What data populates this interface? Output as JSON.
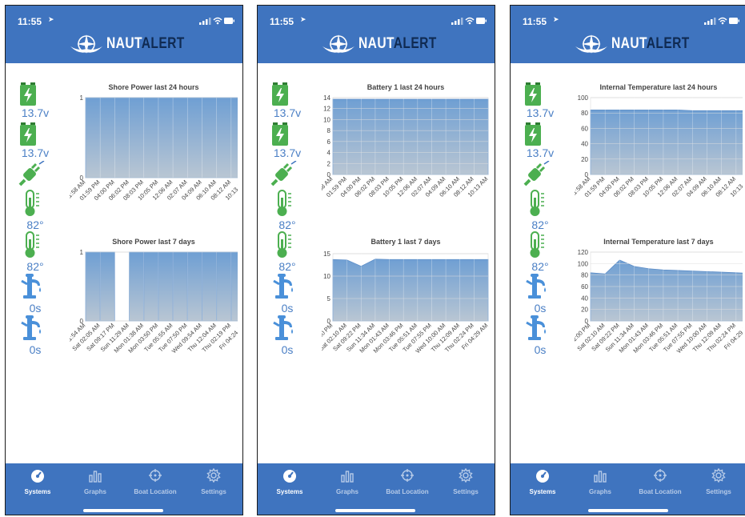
{
  "colors": {
    "header": "#3f74bf",
    "tab_active": "#ffffff",
    "tab_inactive": "#b7cbe8",
    "side_value": "#4a7fc5",
    "battery_icon": "#4caf50",
    "plug_icon": "#4caf50",
    "thermometer_icon": "#4caf50",
    "pump_icon": "#4a90d9",
    "area_top": "#6f9fd3",
    "area_bottom": "#b9c6d3"
  },
  "screens": [
    {
      "status_time": "11:55",
      "logo": {
        "part1": "NAUT",
        "part2": "ALERT"
      },
      "sidebar": [
        {
          "icon": "battery-icon",
          "value": "13.7v"
        },
        {
          "icon": "battery-icon",
          "value": "13.7v"
        },
        {
          "icon": "plug-icon",
          "value": ""
        },
        {
          "icon": "thermometer-icon",
          "value": "82°"
        },
        {
          "icon": "thermometer-icon",
          "value": "82°"
        },
        {
          "icon": "water-pump-icon",
          "value": "0s"
        },
        {
          "icon": "water-pump-icon",
          "value": "0s"
        }
      ],
      "tabs": [
        {
          "label": "Systems",
          "icon": "gauge-icon",
          "active": true
        },
        {
          "label": "Graphs",
          "icon": "bar-chart-icon",
          "active": false
        },
        {
          "label": "Boat Location",
          "icon": "crosshair-icon",
          "active": false
        },
        {
          "label": "Settings",
          "icon": "gear-icon",
          "active": false
        }
      ]
    },
    {
      "status_time": "11:55",
      "logo": {
        "part1": "NAUT",
        "part2": "ALERT"
      },
      "sidebar": [
        {
          "icon": "battery-icon",
          "value": "13.7v"
        },
        {
          "icon": "battery-icon",
          "value": "13.7v"
        },
        {
          "icon": "plug-icon",
          "value": ""
        },
        {
          "icon": "thermometer-icon",
          "value": "82°"
        },
        {
          "icon": "thermometer-icon",
          "value": "82°"
        },
        {
          "icon": "water-pump-icon",
          "value": "0s"
        },
        {
          "icon": "water-pump-icon",
          "value": "0s"
        }
      ],
      "tabs": [
        {
          "label": "Systems",
          "icon": "gauge-icon",
          "active": true
        },
        {
          "label": "Graphs",
          "icon": "bar-chart-icon",
          "active": false
        },
        {
          "label": "Boat Location",
          "icon": "crosshair-icon",
          "active": false
        },
        {
          "label": "Settings",
          "icon": "gear-icon",
          "active": false
        }
      ]
    },
    {
      "status_time": "11:55",
      "logo": {
        "part1": "NAUT",
        "part2": "ALERT"
      },
      "sidebar": [
        {
          "icon": "battery-icon",
          "value": "13.7v"
        },
        {
          "icon": "battery-icon",
          "value": "13.7v"
        },
        {
          "icon": "plug-icon",
          "value": ""
        },
        {
          "icon": "thermometer-icon",
          "value": "82°"
        },
        {
          "icon": "thermometer-icon",
          "value": "82°"
        },
        {
          "icon": "water-pump-icon",
          "value": "0s"
        },
        {
          "icon": "water-pump-icon",
          "value": "0s"
        }
      ],
      "tabs": [
        {
          "label": "Systems",
          "icon": "gauge-icon",
          "active": true
        },
        {
          "label": "Graphs",
          "icon": "bar-chart-icon",
          "active": false
        },
        {
          "label": "Boat Location",
          "icon": "crosshair-icon",
          "active": false
        },
        {
          "label": "Settings",
          "icon": "gear-icon",
          "active": false
        }
      ]
    }
  ],
  "chart_data": [
    {
      "type": "area",
      "title": "Shore Power last 24 hours",
      "ylim": [
        0,
        1
      ],
      "yticks": [
        0,
        1
      ],
      "x_labels": [
        "11:58 AM",
        "01:59 PM",
        "04:00 PM",
        "06:02 PM",
        "08:03 PM",
        "10:05 PM",
        "12:06 AM",
        "02:07 AM",
        "04:09 AM",
        "06:10 AM",
        "08:12 AM",
        "10:13 AM"
      ],
      "values": [
        1,
        1,
        1,
        1,
        1,
        1,
        1,
        1,
        1,
        1,
        1,
        1
      ],
      "grid": true
    },
    {
      "type": "area",
      "title": "Shore Power last 7 days",
      "ylim": [
        0,
        1
      ],
      "yticks": [
        0,
        1
      ],
      "x_labels": [
        "Fri 11:54 AM",
        "Sat 02:05 AM",
        "Sat 09:17 PM",
        "Sun 11:29 AM",
        "Mon 01:38 AM",
        "Mon 03:50 PM",
        "Tue 05:55 AM",
        "Tue 07:50 PM",
        "Wed 09:54 AM",
        "Thu 12:04 AM",
        "Thu 02:19 PM",
        "Fri 04:24 AM"
      ],
      "values": [
        1,
        1,
        0,
        1,
        1,
        1,
        1,
        1,
        1,
        1,
        1,
        1
      ],
      "grid": true
    },
    {
      "type": "area",
      "title": "Battery 1 last 24 hours",
      "ylim": [
        0,
        14
      ],
      "yticks": [
        0,
        2,
        4,
        6,
        8,
        10,
        12,
        14
      ],
      "x_labels": [
        "11:58 AM",
        "01:59 PM",
        "04:00 PM",
        "06:02 PM",
        "08:03 PM",
        "10:05 PM",
        "12:06 AM",
        "02:07 AM",
        "04:09 AM",
        "06:10 AM",
        "08:12 AM",
        "10:13 AM"
      ],
      "values": [
        13.7,
        13.7,
        13.7,
        13.7,
        13.7,
        13.7,
        13.7,
        13.7,
        13.7,
        13.7,
        13.7,
        13.7
      ],
      "grid": true
    },
    {
      "type": "area",
      "title": "Battery 1 last 7 days",
      "ylim": [
        0,
        15
      ],
      "yticks": [
        0,
        5,
        10,
        15
      ],
      "x_labels": [
        "Fri 12:00 PM",
        "Sat 02:10 AM",
        "Sat 09:22 PM",
        "Sun 11:34 AM",
        "Mon 01:43 AM",
        "Mon 03:46 PM",
        "Tue 05:51 AM",
        "Tue 07:55 PM",
        "Wed 10:00 AM",
        "Thu 12:09 AM",
        "Thu 02:24 PM",
        "Fri 04:29 AM"
      ],
      "values": [
        13.7,
        13.6,
        12.2,
        13.8,
        13.7,
        13.7,
        13.7,
        13.7,
        13.7,
        13.7,
        13.7,
        13.7
      ],
      "grid": true
    },
    {
      "type": "area",
      "title": "Internal Temperature last 24 hours",
      "ylim": [
        0,
        100
      ],
      "yticks": [
        0,
        20,
        40,
        60,
        80,
        100
      ],
      "x_labels": [
        "11:58 AM",
        "01:59 PM",
        "04:00 PM",
        "06:02 PM",
        "08:03 PM",
        "10:05 PM",
        "12:06 AM",
        "02:07 AM",
        "04:09 AM",
        "06:10 AM",
        "08:12 AM",
        "10:13 AM"
      ],
      "values": [
        84,
        84,
        84,
        84,
        84,
        84,
        84,
        83,
        83,
        83,
        83,
        83
      ],
      "grid": true
    },
    {
      "type": "area",
      "title": "Internal Temperature last 7 days",
      "ylim": [
        0,
        120
      ],
      "yticks": [
        0,
        20,
        40,
        60,
        80,
        100,
        120
      ],
      "x_labels": [
        "Fri 12:00 PM",
        "Sat 02:10 AM",
        "Sat 09:22 PM",
        "Sun 11:34 AM",
        "Mon 01:43 AM",
        "Mon 03:46 PM",
        "Tue 05:51 AM",
        "Tue 07:55 PM",
        "Wed 10:00 AM",
        "Thu 12:09 AM",
        "Thu 02:24 PM",
        "Fri 04:29 AM"
      ],
      "values": [
        84,
        82,
        106,
        95,
        91,
        89,
        88,
        87,
        86,
        85,
        84,
        83
      ],
      "grid": true
    }
  ]
}
